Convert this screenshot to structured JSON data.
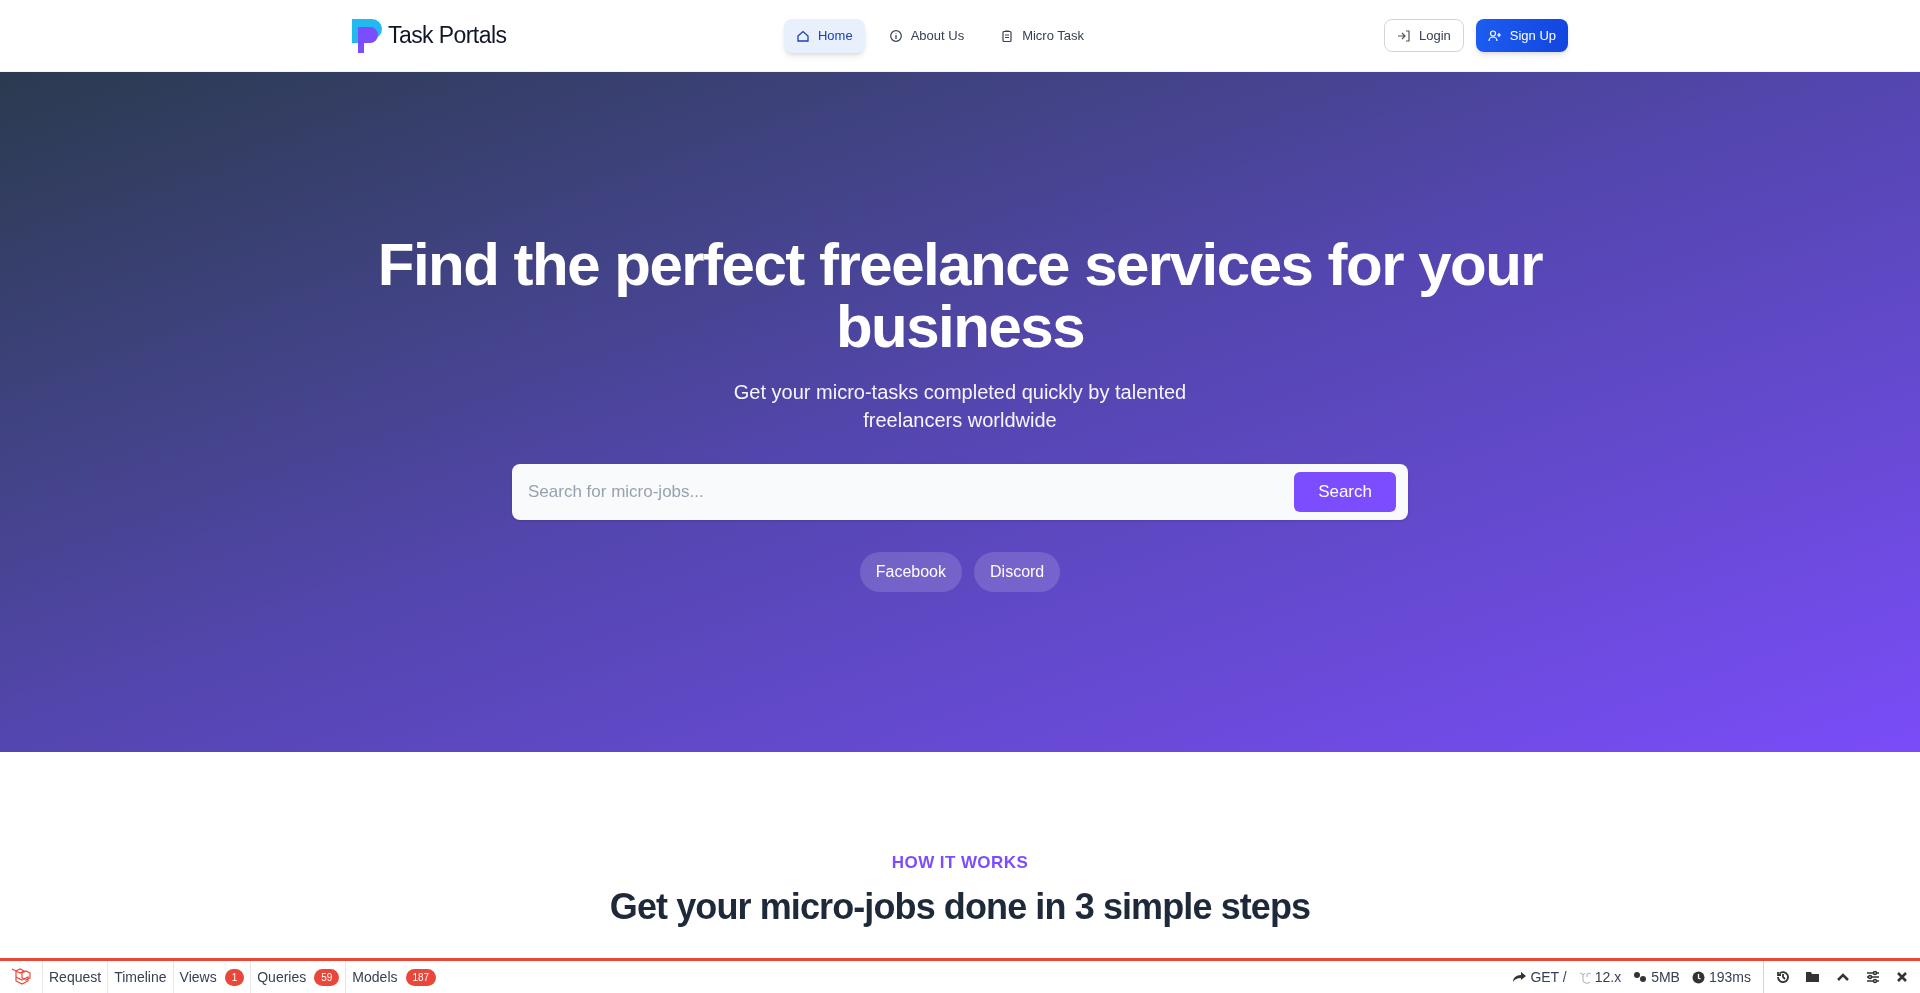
{
  "brand": {
    "name": "Task Portals"
  },
  "nav": [
    {
      "label": "Home",
      "kind": "home",
      "selected": true
    },
    {
      "label": "About Us",
      "kind": "info",
      "selected": false
    },
    {
      "label": "Micro Task",
      "kind": "tasks",
      "selected": false
    }
  ],
  "auth": {
    "login": "Login",
    "signup": "Sign Up"
  },
  "hero": {
    "title": "Find the perfect freelance services for your business",
    "subtitle": "Get your micro-tasks completed quickly by talented freelancers worldwide",
    "search": {
      "placeholder": "Search for micro-jobs...",
      "button": "Search"
    },
    "social": [
      "Facebook",
      "Discord"
    ]
  },
  "how": {
    "eyebrow": "HOW IT WORKS",
    "heading": "Get your micro-jobs done in 3 simple steps"
  },
  "debugbar": {
    "tabs": [
      {
        "label": "Request"
      },
      {
        "label": "Timeline"
      },
      {
        "label": "Views",
        "count": "1"
      },
      {
        "label": "Queries",
        "count": "59"
      },
      {
        "label": "Models",
        "count": "187"
      }
    ],
    "stats": [
      {
        "kind": "route",
        "text": "GET /"
      },
      {
        "kind": "version",
        "text": "12.x"
      },
      {
        "kind": "memory",
        "text": "5MB"
      },
      {
        "kind": "time",
        "text": "193ms"
      }
    ]
  }
}
